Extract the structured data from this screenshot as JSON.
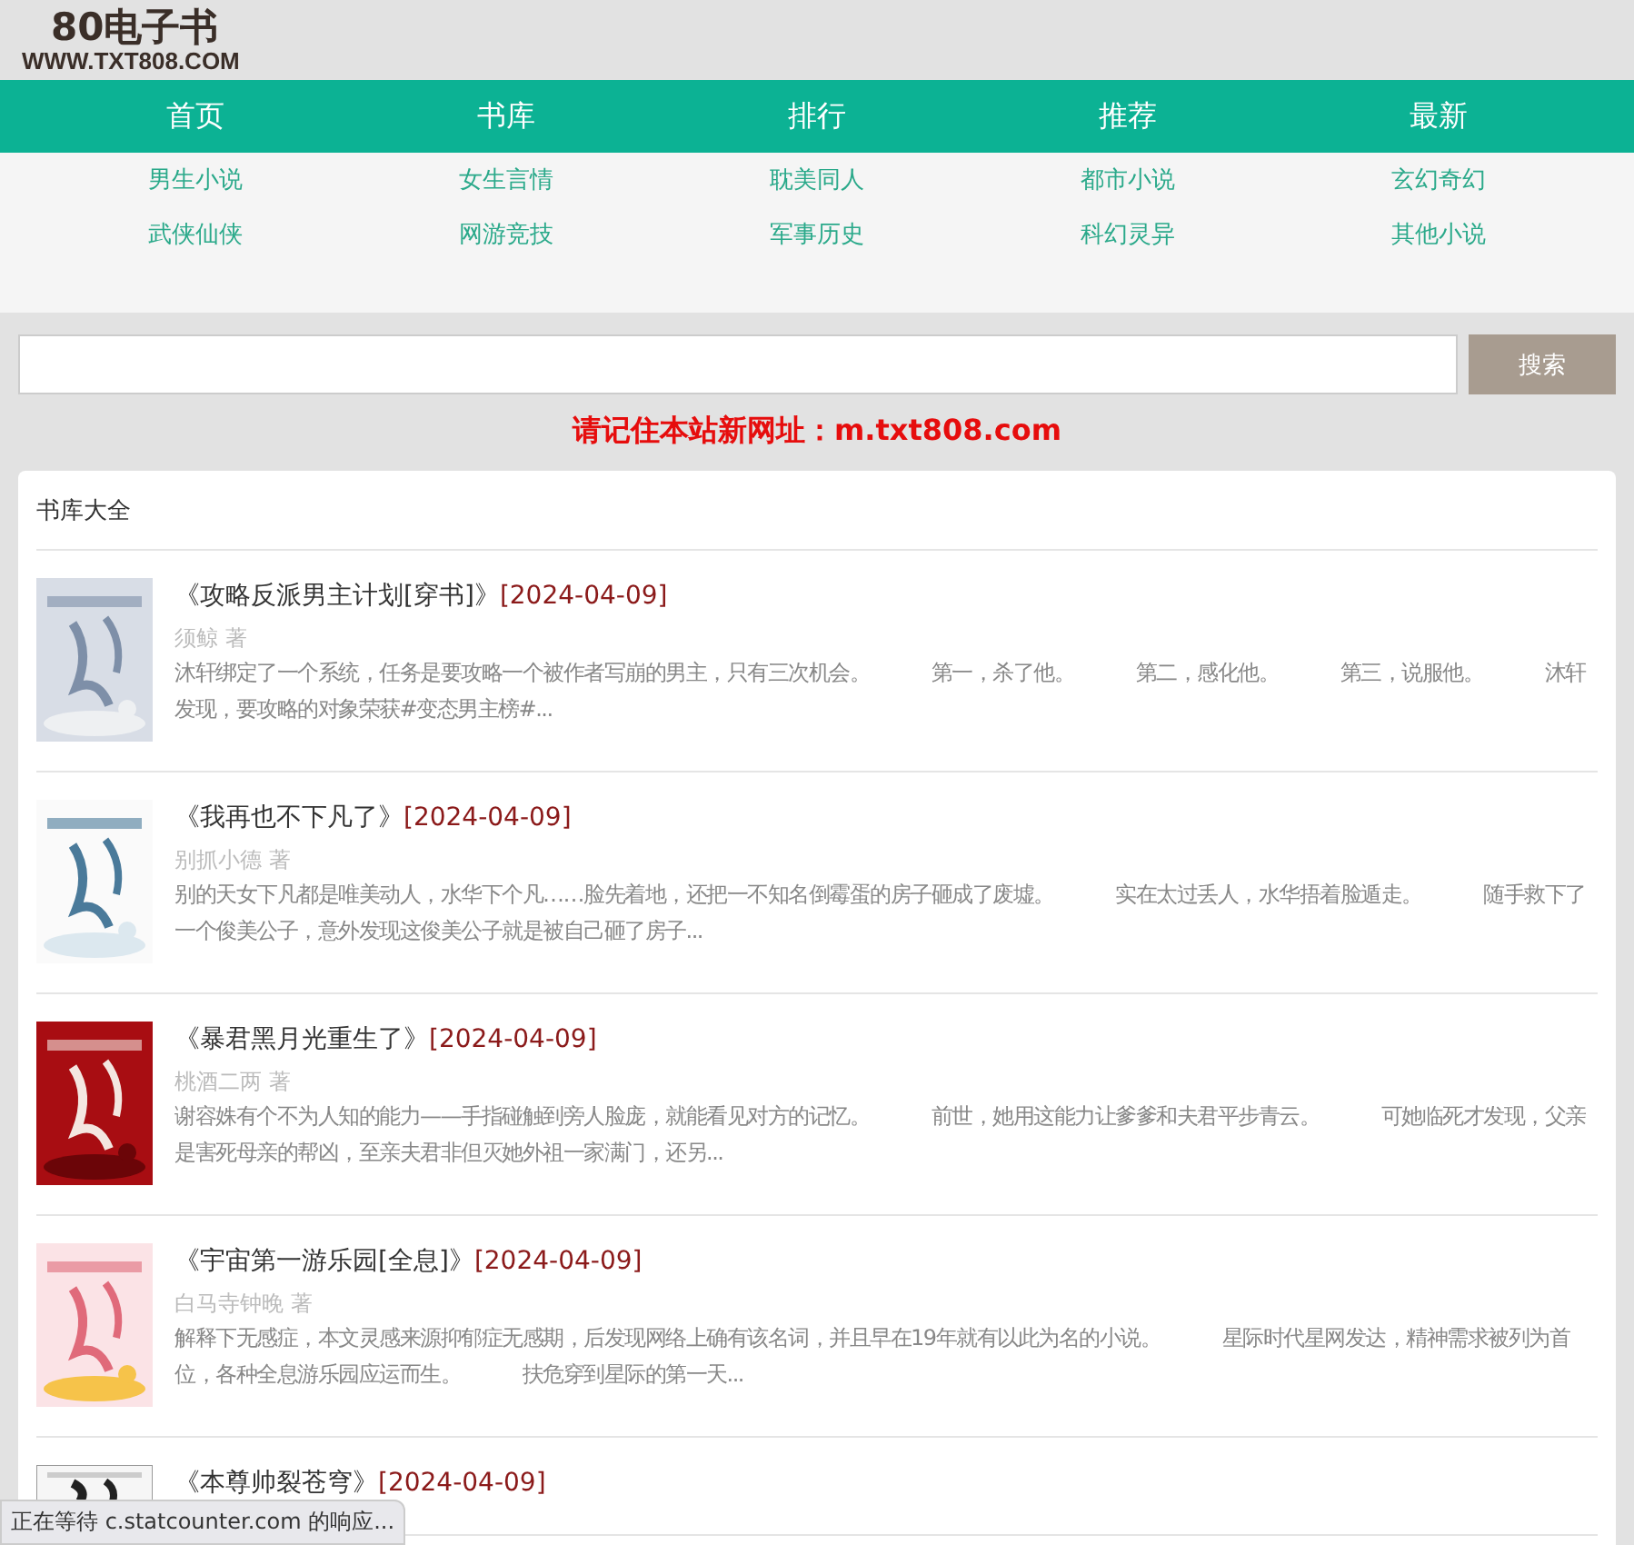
{
  "logo": {
    "title": "80电子书",
    "url": "WWW.TXT808.COM"
  },
  "nav": [
    "首页",
    "书库",
    "排行",
    "推荐",
    "最新"
  ],
  "categories": [
    "男生小说",
    "女生言情",
    "耽美同人",
    "都市小说",
    "玄幻奇幻",
    "武侠仙侠",
    "网游竞技",
    "军事历史",
    "科幻灵异",
    "其他小说"
  ],
  "search": {
    "button": "搜索"
  },
  "notice": "请记住本站新网址：m.txt808.com",
  "library": {
    "title": "书库大全",
    "books": [
      {
        "title": "《攻略反派男主计划[穿书]》",
        "date": "[2024-04-09]",
        "author": "须鲸 著",
        "summary": "沐轩绑定了一个系统，任务是要攻略一个被作者写崩的男主，只有三次机会。　　　第一，杀了他。　　　第二，感化他。　　　第三，说服他。　　　沐轩发现，要攻略的对象荣获#变态男主榜#..."
      },
      {
        "title": "《我再也不下凡了》",
        "date": "[2024-04-09]",
        "author": "别抓小德 著",
        "summary": "别的天女下凡都是唯美动人，水华下个凡……脸先着地，还把一不知名倒霉蛋的房子砸成了废墟。　　　实在太过丢人，水华捂着脸遁走。　　　随手救下了一个俊美公子，意外发现这俊美公子就是被自己砸了房子..."
      },
      {
        "title": "《暴君黑月光重生了》",
        "date": "[2024-04-09]",
        "author": "桃酒二两 著",
        "summary": "谢容姝有个不为人知的能力——手指碰触到旁人脸庞，就能看见对方的记忆。　　　前世，她用这能力让爹爹和夫君平步青云。　　　可她临死才发现，父亲是害死母亲的帮凶，至亲夫君非但灭她外祖一家满门，还另..."
      },
      {
        "title": "《宇宙第一游乐园[全息]》",
        "date": "[2024-04-09]",
        "author": "白马寺钟晚 著",
        "summary": "解释下无感症，本文灵感来源抑郁症无感期，后发现网络上确有该名词，并且早在19年就有以此为名的小说。　　　星际时代星网发达，精神需求被列为首位，各种全息游乐园应运而生。　　　扶危穿到星际的第一天..."
      },
      {
        "title": "《本尊帅裂苍穹》",
        "date": "[2024-04-09]"
      }
    ]
  },
  "status_bar": "正在等待 c.statcounter.com 的响应..."
}
